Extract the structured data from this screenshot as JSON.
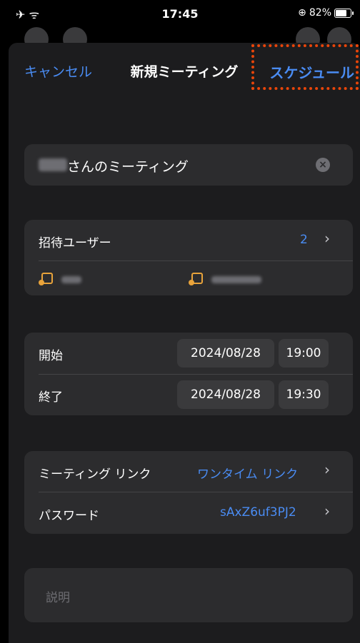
{
  "status_bar": {
    "left_icons": "✈ ᯤ",
    "time": "17:45",
    "battery_text": "82%",
    "battery_level": 0.82
  },
  "nav": {
    "cancel_label": "キャンセル",
    "title": "新規ミーティング",
    "schedule_label": "スケジュール"
  },
  "meeting_title": {
    "value": "さんのミーティング",
    "clear_icon": "x-circle-icon"
  },
  "invitees": {
    "label": "招待ユーザー",
    "count": "2",
    "chevron": "›"
  },
  "schedule": {
    "start_label": "開始",
    "start_date": "2024/08/28",
    "start_time": "19:00",
    "end_label": "終了",
    "end_date": "2024/08/28",
    "end_time": "19:30"
  },
  "link": {
    "label": "ミーティング リンク",
    "value": "ワンタイム リンク",
    "chevron": "›"
  },
  "password": {
    "label": "パスワード",
    "value": "sAxZ6uf3PJ2",
    "chevron": "›"
  },
  "description": {
    "placeholder": "説明"
  },
  "colors": {
    "accent": "#4a8cf3",
    "highlight": "#e8450a",
    "calendar_icon": "#e8a33b"
  }
}
